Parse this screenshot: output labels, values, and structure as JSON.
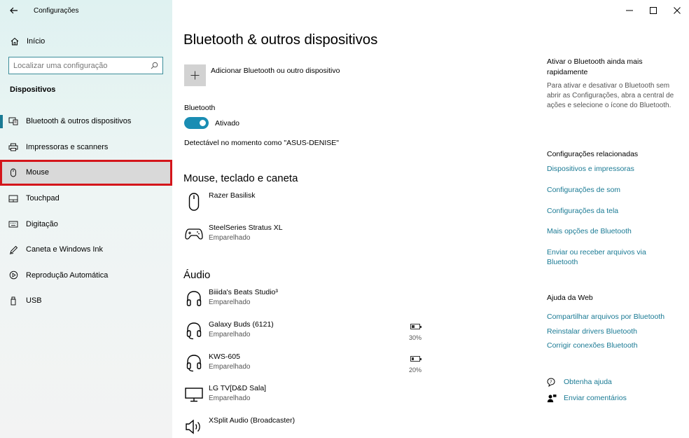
{
  "app": {
    "title": "Configurações"
  },
  "sidebar": {
    "home_label": "Início",
    "search_placeholder": "Localizar uma configuração",
    "section_title": "Dispositivos",
    "items": [
      {
        "label": "Bluetooth & outros dispositivos",
        "icon": "bluetooth-devices-icon"
      },
      {
        "label": "Impressoras e scanners",
        "icon": "printer-icon"
      },
      {
        "label": "Mouse",
        "icon": "mouse-icon"
      },
      {
        "label": "Touchpad",
        "icon": "touchpad-icon"
      },
      {
        "label": "Digitação",
        "icon": "keyboard-icon"
      },
      {
        "label": "Caneta e Windows Ink",
        "icon": "pen-icon"
      },
      {
        "label": "Reprodução Automática",
        "icon": "autoplay-icon"
      },
      {
        "label": "USB",
        "icon": "usb-icon"
      }
    ]
  },
  "main": {
    "title": "Bluetooth & outros dispositivos",
    "add_label": "Adicionar Bluetooth ou outro dispositivo",
    "bluetooth_label": "Bluetooth",
    "toggle_state": "Ativado",
    "discoverable": "Detectável no momento como \"ASUS-DENISE\"",
    "groups": {
      "input": {
        "title": "Mouse, teclado e caneta",
        "devices": [
          {
            "name": "Razer Basilisk",
            "status": ""
          },
          {
            "name": "SteelSeries Stratus XL",
            "status": "Emparelhado"
          }
        ]
      },
      "audio": {
        "title": "Áudio",
        "devices": [
          {
            "name": "Biiida's Beats Studio³",
            "status": "Emparelhado"
          },
          {
            "name": "Galaxy Buds (6121)",
            "status": "Emparelhado",
            "battery": "30%"
          },
          {
            "name": "KWS-605",
            "status": "Emparelhado",
            "battery": "20%"
          },
          {
            "name": "LG TV[D&D Sala]",
            "status": "Emparelhado"
          },
          {
            "name": "XSplit Audio (Broadcaster)",
            "status": ""
          }
        ]
      }
    }
  },
  "right": {
    "quick_title": "Ativar o Bluetooth ainda mais rapidamente",
    "quick_text": "Para ativar e desativar o Bluetooth sem abrir as Configurações, abra a central de ações e selecione o ícone do Bluetooth.",
    "related_title": "Configurações relacionadas",
    "related_links": [
      "Dispositivos e impressoras",
      "Configurações de som",
      "Configurações da tela",
      "Mais opções de Bluetooth",
      "Enviar ou receber arquivos via Bluetooth"
    ],
    "web_title": "Ajuda da Web",
    "web_links": [
      "Compartilhar arquivos por Bluetooth",
      "Reinstalar drivers Bluetooth",
      "Corrigir conexões Bluetooth"
    ],
    "get_help": "Obtenha ajuda",
    "feedback": "Enviar comentários"
  },
  "colors": {
    "accent": "#1a7a94",
    "toggle": "#1a8db3",
    "highlight_border": "#d4151b"
  }
}
